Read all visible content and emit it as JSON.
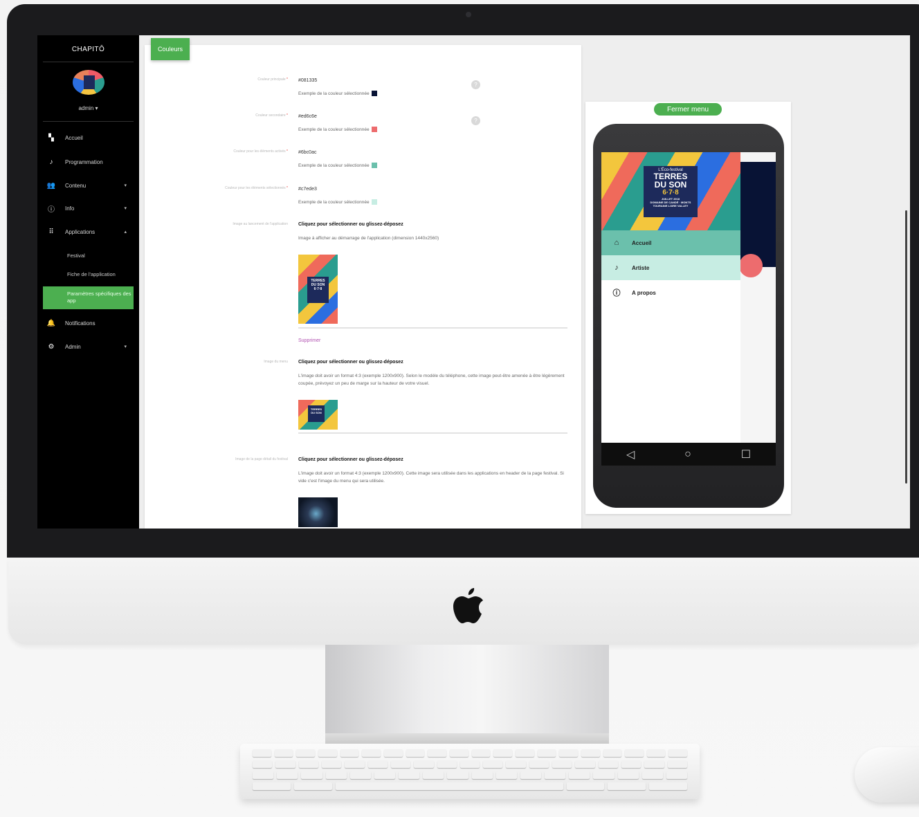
{
  "sidebar": {
    "brand": "CHAPITÔ",
    "user": "admin ▾",
    "nav": [
      {
        "label": "Accueil",
        "icon": "dashboard-icon"
      },
      {
        "label": "Programmation",
        "icon": "music-note-icon"
      },
      {
        "label": "Contenu",
        "icon": "people-icon",
        "chevron": "▾"
      },
      {
        "label": "Info",
        "icon": "info-icon",
        "chevron": "▾"
      },
      {
        "label": "Applications",
        "icon": "apps-grid-icon",
        "chevron": "▴"
      }
    ],
    "sub": [
      "Festival",
      "Fiche de l'application"
    ],
    "active": "Paramètres spécifiques des app",
    "nav_bottom": [
      {
        "label": "Notifications",
        "icon": "bell-icon"
      },
      {
        "label": "Admin",
        "icon": "gear-icon",
        "chevron": "▾"
      }
    ]
  },
  "form": {
    "tab": "Couleurs",
    "colors": [
      {
        "label": "Couleur principale",
        "value": "#081335",
        "example": "Exemple de la couleur sélectionnée",
        "swatch": "#081335"
      },
      {
        "label": "Couleur secondaire",
        "value": "#ed6c6e",
        "example": "Exemple de la couleur sélectionnée",
        "swatch": "#ed6c6e"
      },
      {
        "label": "Couleur pour les éléments activés",
        "value": "#6bc0ac",
        "example": "Exemple de la couleur sélectionnée",
        "swatch": "#6bc0ac"
      },
      {
        "label": "Couleur pour les éléments sélectionnés",
        "value": "#c7ede3",
        "example": "Exemple de la couleur sélectionnée",
        "swatch": "#c7ede3"
      }
    ],
    "required_mark": "*",
    "help_mark": "?",
    "launch": {
      "label": "Image au lancement de l'application",
      "cta": "Cliquez pour sélectionner ou glissez-déposez",
      "help": "Image à afficher au démarrage de l'application (dimension 1440x2560)",
      "delete": "Supprimer"
    },
    "menu": {
      "label": "Image du menu",
      "cta": "Cliquez pour sélectionner ou glissez-déposez",
      "help": "L'image doit avoir un format 4:3 (exemple 1200x900). Selon le modèle du téléphone, cette image peut-être amenée à être légèrement coupée, prévoyez un peu de marge sur la hauteur de votre visuel."
    },
    "detail": {
      "label": "Image de la page détail du festival",
      "cta": "Cliquez pour sélectionner ou glissez-déposez",
      "help": "L'image doit avoir un format 4:3 (exemple 1200x900). Cette image sera utilisée dans les applications en header de la page festival. Si vide c'est l'image du menu qui sera utilisée."
    }
  },
  "preview": {
    "close_button": "Fermer menu",
    "poster": {
      "line1": "L'Éco-festival",
      "line2": "TERRES",
      "line3": "DU SON",
      "line4": "6·7·8",
      "line5": "JUILLET 2018",
      "line6": "DOMAINE DE CANDÉ · MONTS",
      "line7": "TOURAINE LOIRE VALLEY"
    },
    "menu": [
      {
        "label": "Accueil",
        "icon": "home-icon",
        "bg": "#6bc0ac"
      },
      {
        "label": "Artiste",
        "icon": "music-note-icon",
        "bg": "#c7ede3"
      },
      {
        "label": "A propos",
        "icon": "info-icon",
        "bg": "#ffffff"
      }
    ],
    "navbar": [
      "◁",
      "○",
      "☐"
    ]
  }
}
